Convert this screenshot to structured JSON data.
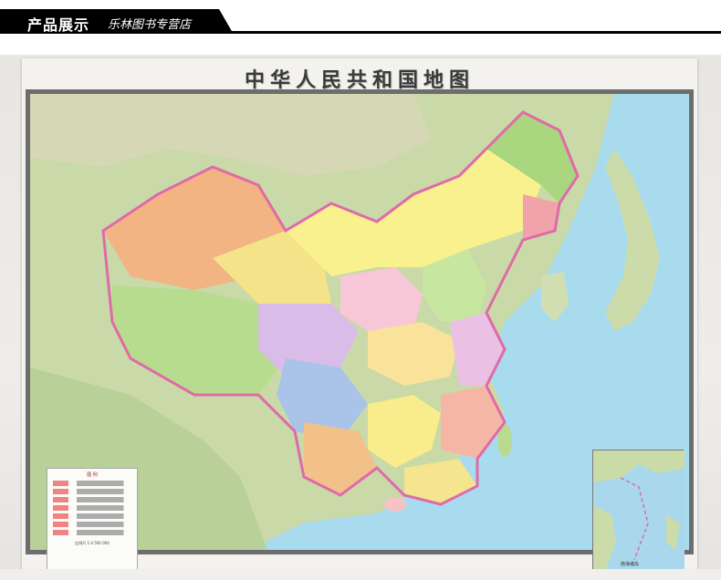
{
  "header": {
    "title": "产品展示",
    "subtitle": "乐林图书专营店"
  },
  "map": {
    "title": "中华人民共和国地图",
    "legend_heading": "图 例",
    "scale_text": "比例尺 1:4 500 000",
    "inset_label": "南海诸岛"
  }
}
